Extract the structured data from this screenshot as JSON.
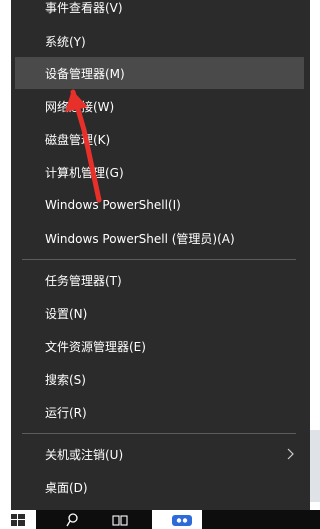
{
  "menu": {
    "items": [
      {
        "label": "事件查看器(V)"
      },
      {
        "label": "系统(Y)"
      },
      {
        "label": "设备管理器(M)"
      },
      {
        "label": "网络连接(W)"
      },
      {
        "label": "磁盘管理(K)"
      },
      {
        "label": "计算机管理(G)"
      },
      {
        "label": "Windows PowerShell(I)"
      },
      {
        "label": "Windows PowerShell (管理员)(A)"
      },
      {
        "label": "任务管理器(T)"
      },
      {
        "label": "设置(N)"
      },
      {
        "label": "文件资源管理器(E)"
      },
      {
        "label": "搜索(S)"
      },
      {
        "label": "运行(R)"
      },
      {
        "label": "关机或注销(U)"
      },
      {
        "label": "桌面(D)"
      }
    ],
    "highlighted_item": "设备管理器(M)",
    "submenu_indicator": "chevron-right-icon"
  },
  "taskbar": {
    "icons": [
      "windows-logo-icon",
      "search-icon",
      "task-view-icon",
      "app-icon",
      "baidu-icon"
    ]
  },
  "colors": {
    "menu_bg": "#2b2b2b",
    "highlight_bg": "#4a4a4a",
    "text": "#ffffff",
    "annotation_arrow": "#e8302a"
  }
}
